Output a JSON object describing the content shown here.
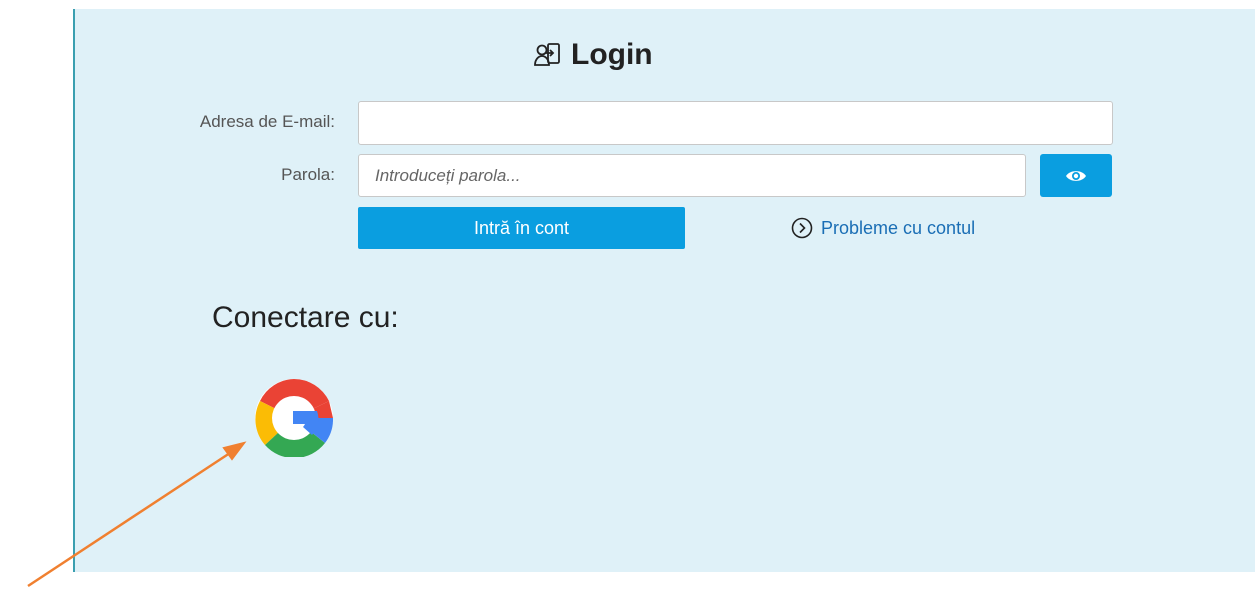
{
  "login": {
    "title": "Login",
    "email_label": "Adresa de E-mail:",
    "email_value": "",
    "password_label": "Parola:",
    "password_placeholder": "Introduceți parola...",
    "submit_label": "Intră în cont",
    "problems_link": "Probleme cu contul"
  },
  "social": {
    "heading": "Conectare cu:",
    "providers": [
      "google-icon"
    ]
  },
  "colors": {
    "panel_bg": "#dff1f8",
    "accent_blue": "#0a9ee0",
    "link_blue": "#1a6eb5",
    "annotation_arrow": "#f08030"
  }
}
